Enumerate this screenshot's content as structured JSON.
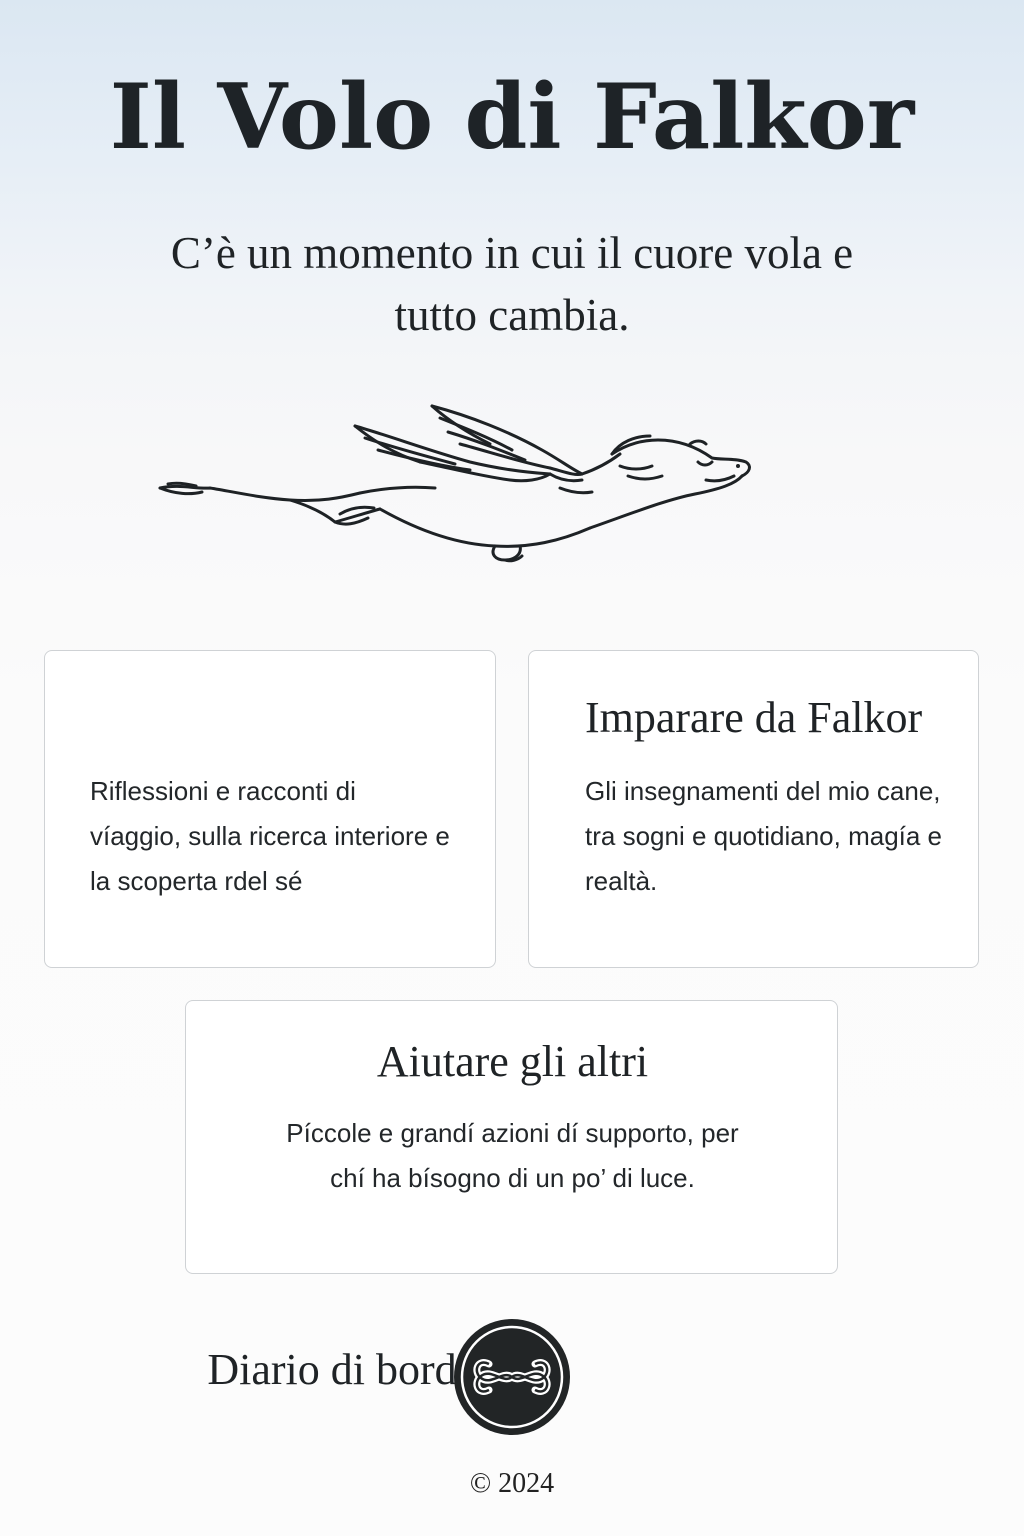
{
  "header": {
    "title": "Il Volo di Falkor",
    "tagline": "C’è un momento in cui il cuore vola e tutto cambia."
  },
  "hero": {
    "illustration": "flying-dragon-dog-illustration"
  },
  "cards": [
    {
      "title": "Diario di bordo",
      "text": "Riflessioni e racconti di víaggio, sulla ricerca interiore e la scoperta rdel sé"
    },
    {
      "title": "Imparare da Falkor",
      "text": "Gli insegnamenti del mio cane, tra sogni e quotidiano, magía e realtà."
    },
    {
      "title": "Aiutare gli altri",
      "text": "Píccole e grandí azioni dí supporto, per chí ha bísogno di un po’ di luce."
    }
  ],
  "footer": {
    "logo_icon": "auryn-infinity-logo-icon",
    "copyright": "© 2024"
  },
  "colors": {
    "sky_top": "#dbe7f2",
    "background": "#fcfcfc",
    "text": "#1f2326",
    "card_border": "#cfd2d5"
  }
}
